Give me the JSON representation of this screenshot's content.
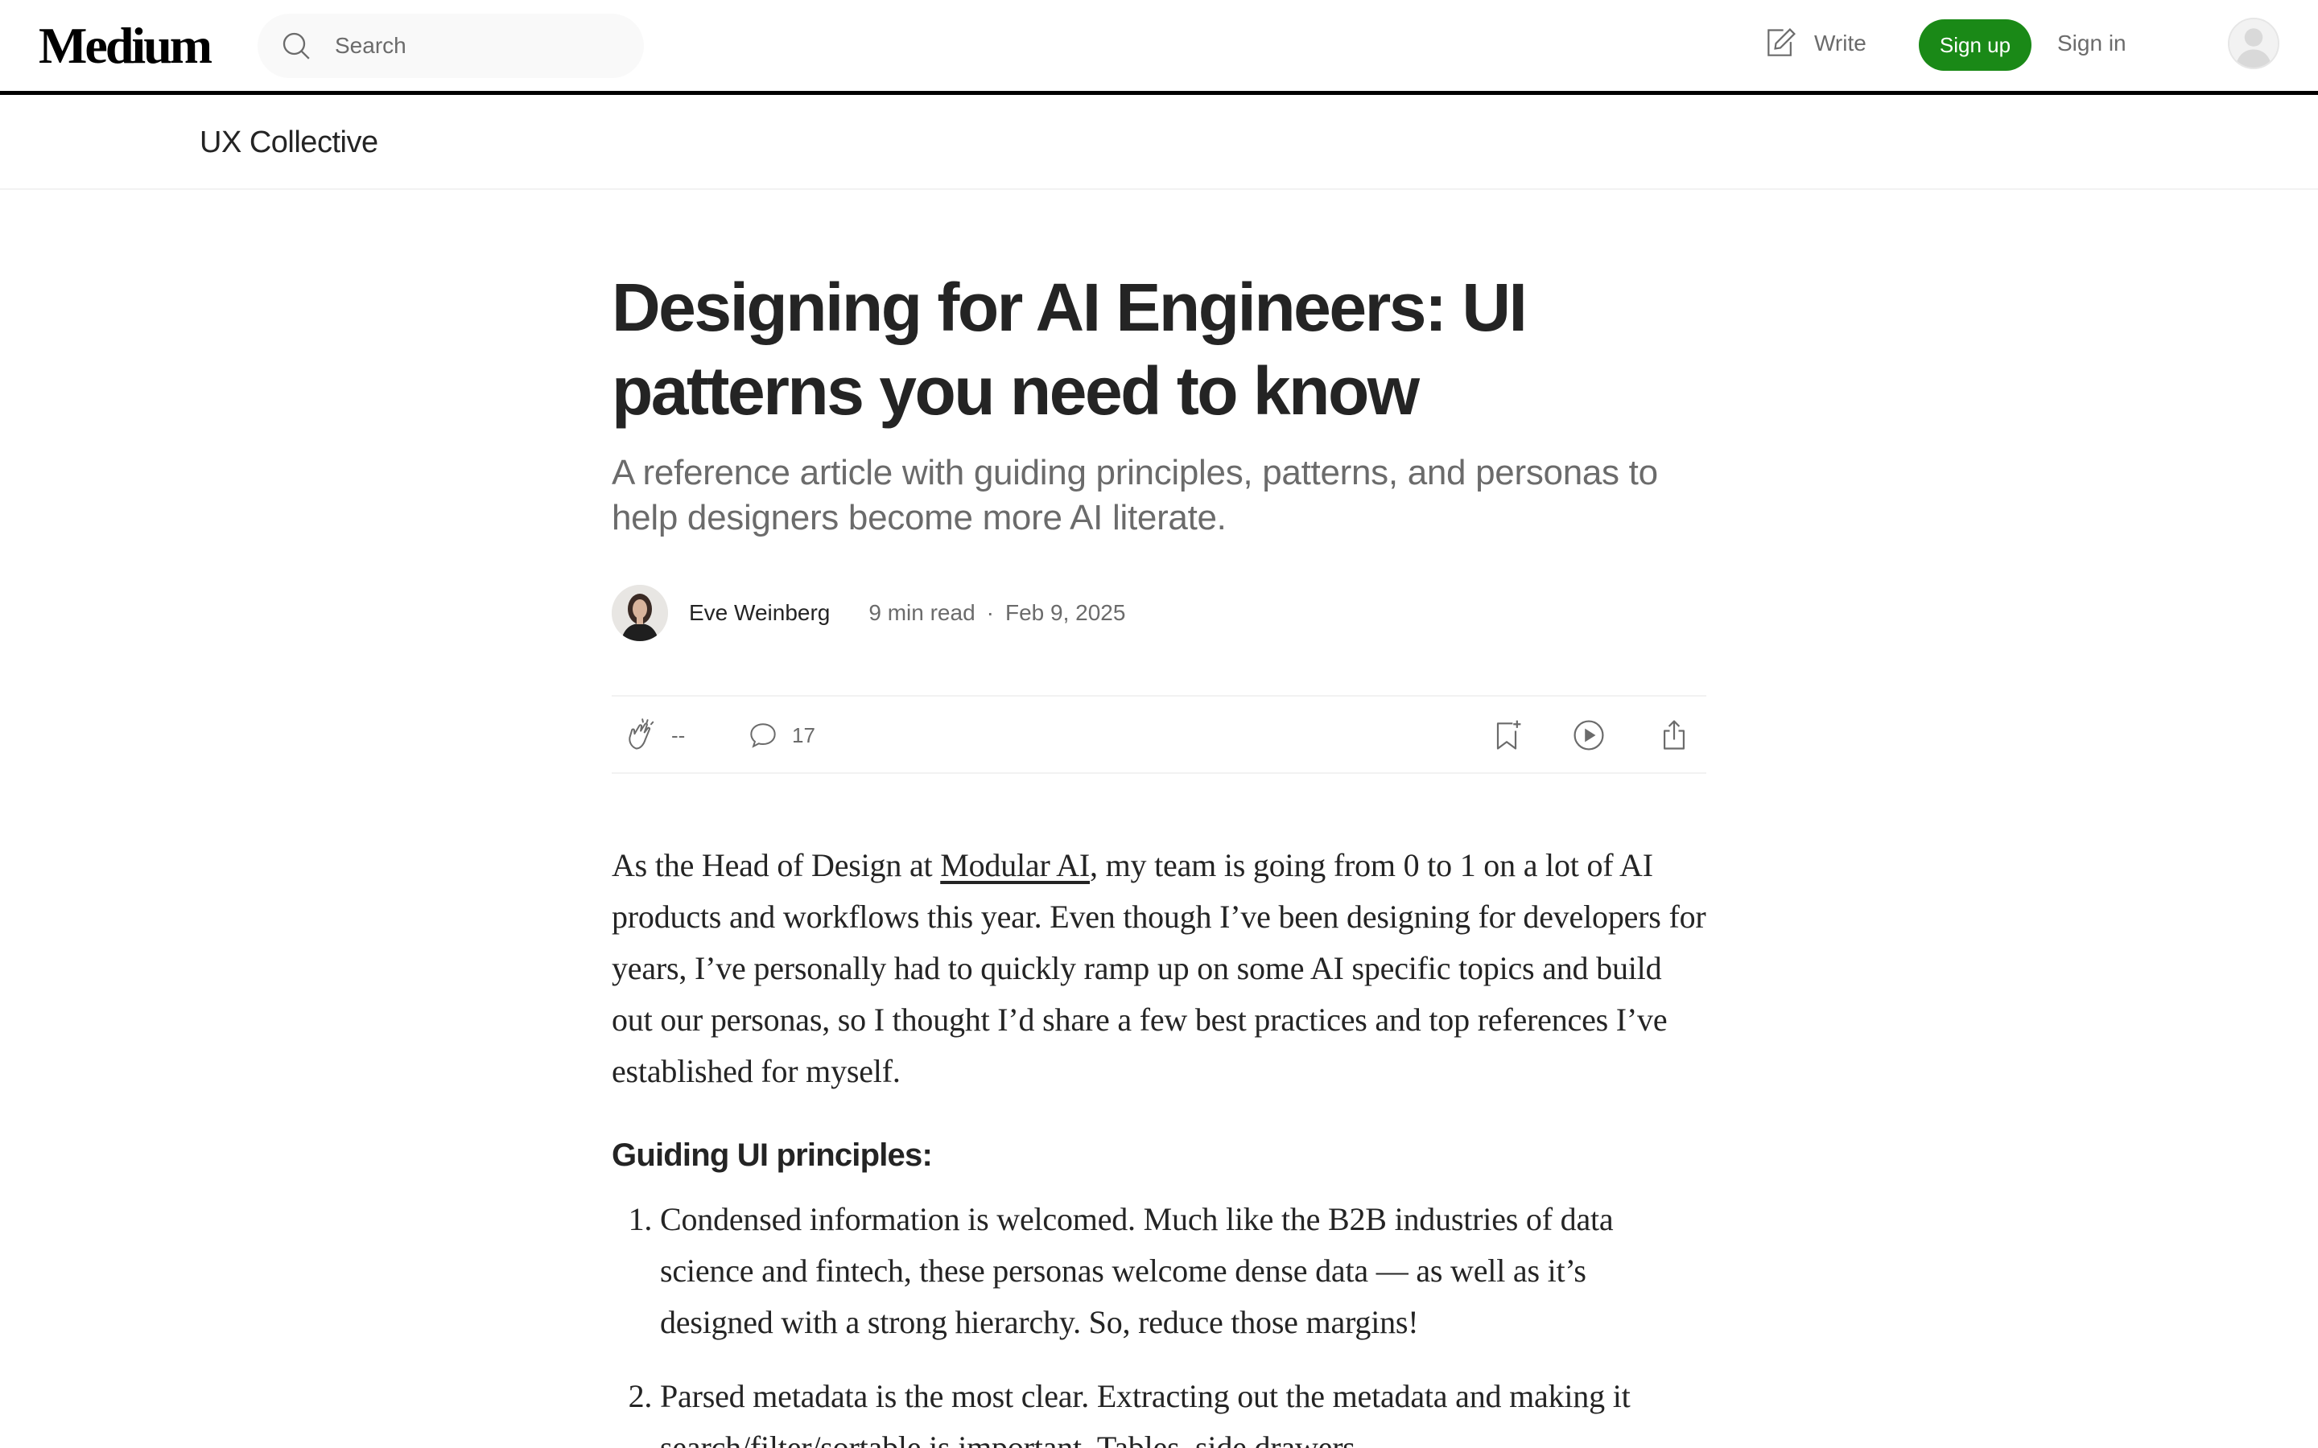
{
  "header": {
    "logo": "Medium",
    "search_placeholder": "Search",
    "write_label": "Write",
    "signup_label": "Sign up",
    "signin_label": "Sign in",
    "accent_color": "#1a8917"
  },
  "publication": {
    "name": "UX Collective"
  },
  "article": {
    "title": "Designing for AI Engineers: UI patterns you need to know",
    "subtitle": "A reference article with guiding principles, patterns, and personas to help designers become more AI literate.",
    "author": "Eve Weinberg",
    "read_time": "9 min read",
    "separator": "·",
    "date": "Feb 9, 2025",
    "claps": "--",
    "responses": "17"
  },
  "body": {
    "intro_before_link": "As the Head of Design at ",
    "intro_link": "Modular AI",
    "intro_after_link": ", my team is going from 0 to 1 on a lot of AI products and workflows this year. Even though I’ve been designing for developers for years, I’ve personally had to quickly ramp up on some AI specific topics and build out our personas, so I thought I’d share a few best practices and top references I’ve established for myself.",
    "section_heading": "Guiding UI principles:",
    "principles": [
      "Condensed information is welcomed. Much like the B2B industries of data science and fintech, these personas welcome dense data — as well as it’s designed with a strong hierarchy. So, reduce those margins!",
      "Parsed metadata is the most clear. Extracting out the metadata and making it search/filter/sortable is important. Tables, side drawers,"
    ]
  }
}
